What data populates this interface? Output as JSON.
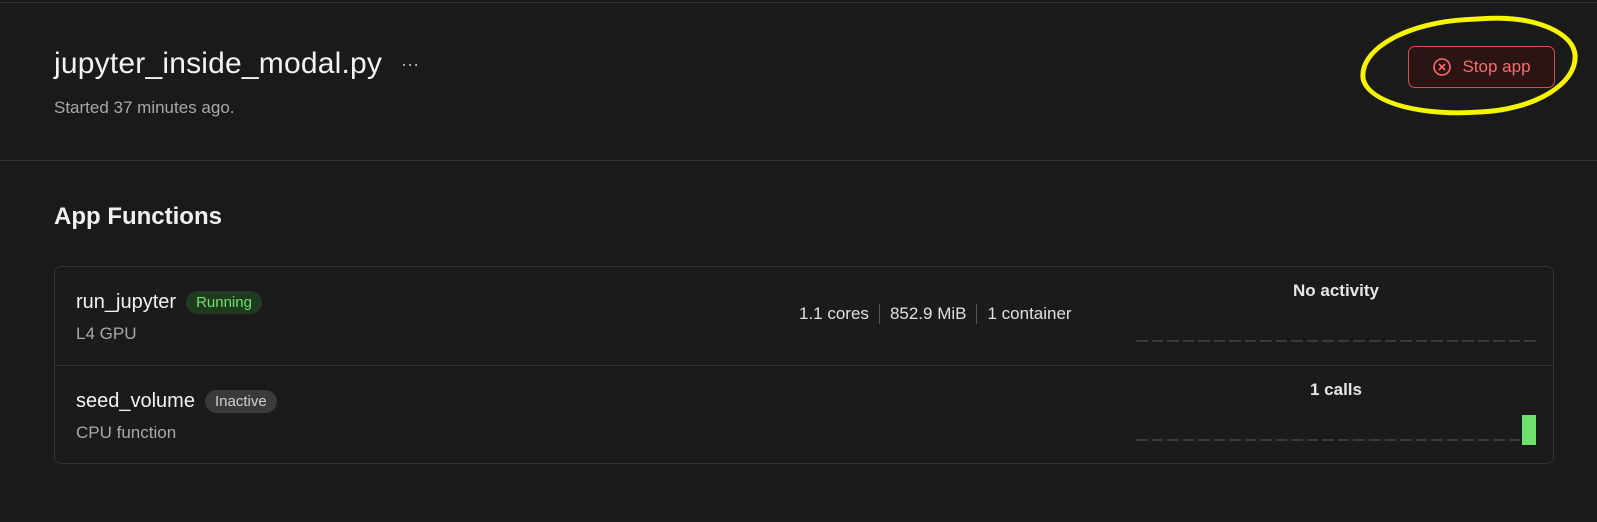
{
  "header": {
    "title": "jupyter_inside_modal.py",
    "more_glyph": "···",
    "started": "Started 37 minutes ago.",
    "stop_label": "Stop app"
  },
  "section": {
    "title": "App Functions"
  },
  "functions": [
    {
      "name": "run_jupyter",
      "status": "Running",
      "subtitle": "L4 GPU",
      "stats": [
        "1.1 cores",
        "852.9 MiB",
        "1 container"
      ],
      "activity_label": "No activity",
      "calls_bar_level": 0
    },
    {
      "name": "seed_volume",
      "status": "Inactive",
      "subtitle": "CPU function",
      "activity_label": "1 calls",
      "calls_bar_level": 1
    }
  ],
  "colors": {
    "danger": "#ff6b6b",
    "highlight": "#f5f500",
    "running": "#6ee06e"
  },
  "icons": {
    "stop": "x-circle-icon",
    "more": "more-horizontal-icon"
  }
}
